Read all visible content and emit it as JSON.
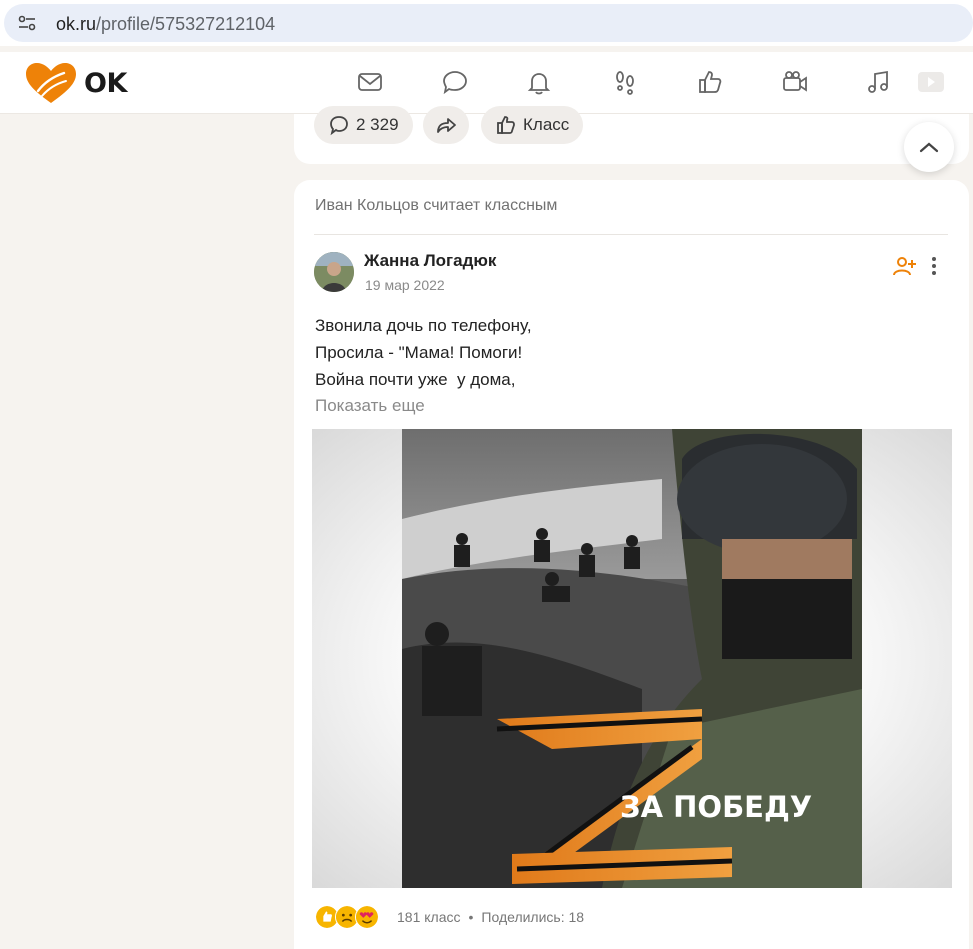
{
  "browser": {
    "url_host": "ok.ru",
    "url_path": "/profile/575327212104"
  },
  "header": {
    "logo_text": "OK",
    "nav_icons": [
      "mail-icon",
      "chat-icon",
      "bell-icon",
      "guests-icon",
      "like-icon",
      "video-icon",
      "music-icon",
      "play-icon"
    ]
  },
  "prev_post": {
    "comments_count": "2 329",
    "like_label": "Класс"
  },
  "post": {
    "liked_by": "Иван Кольцов считает классным",
    "author": "Жанна Логадюк",
    "date": "19 мар 2022",
    "text_lines": [
      "Звонила дочь по телефону,",
      "Просила - \"Мама! Помоги!",
      "Война почти уже  у дома,"
    ],
    "show_more": "Показать еще",
    "image_caption": "ЗА  ПОБЕДУ",
    "likes": "181 класс",
    "shares": "Поделились: 18"
  },
  "colors": {
    "accent": "#ee8208",
    "background": "#f6f3ef"
  }
}
